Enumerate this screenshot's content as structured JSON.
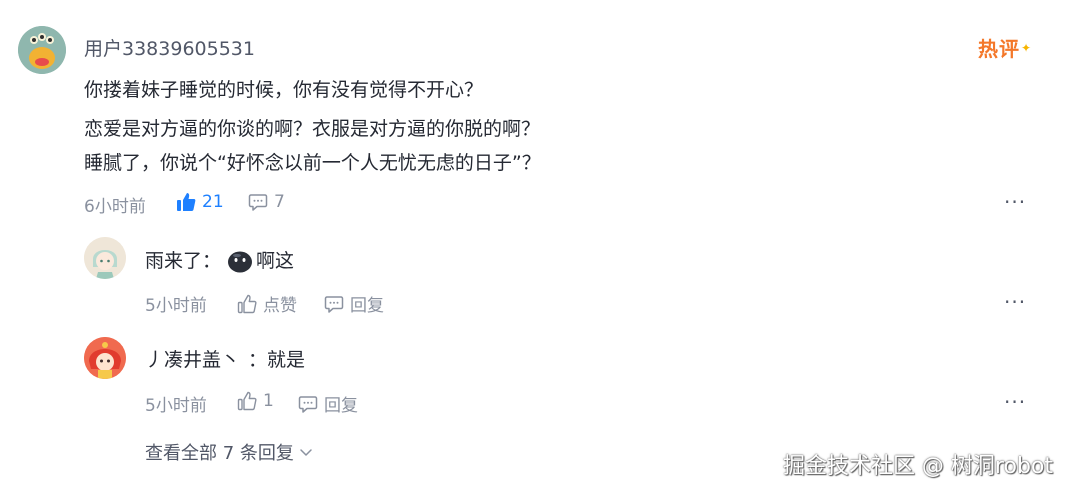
{
  "comment": {
    "username": "用户33839605531",
    "hot_badge": "热评",
    "lines": [
      "你搂着妹子睡觉的时候，你有没有觉得不开心？",
      "恋爱是对方逼的你谈的啊？衣服是对方逼的你脱的啊？",
      "睡腻了，你说个“好怀念以前一个人无忧无虑的日子”？"
    ],
    "time": "6小时前",
    "like_count": "21",
    "comment_count": "7",
    "more": "···"
  },
  "replies": [
    {
      "username": "雨来了：",
      "text": "啊这",
      "time": "5小时前",
      "like_label": "点赞",
      "reply_label": "回复",
      "more": "···"
    },
    {
      "username": "丿凑井盖丶",
      "separator": "：",
      "text": "就是",
      "time": "5小时前",
      "like_count": "1",
      "reply_label": "回复",
      "more": "···"
    }
  ],
  "view_all": "查看全部 7 条回复",
  "watermark": "掘金技术社区 @ 树洞robot",
  "colors": {
    "accent": "#1e80ff",
    "hot": "#f4782a",
    "muted": "#8a919f"
  }
}
